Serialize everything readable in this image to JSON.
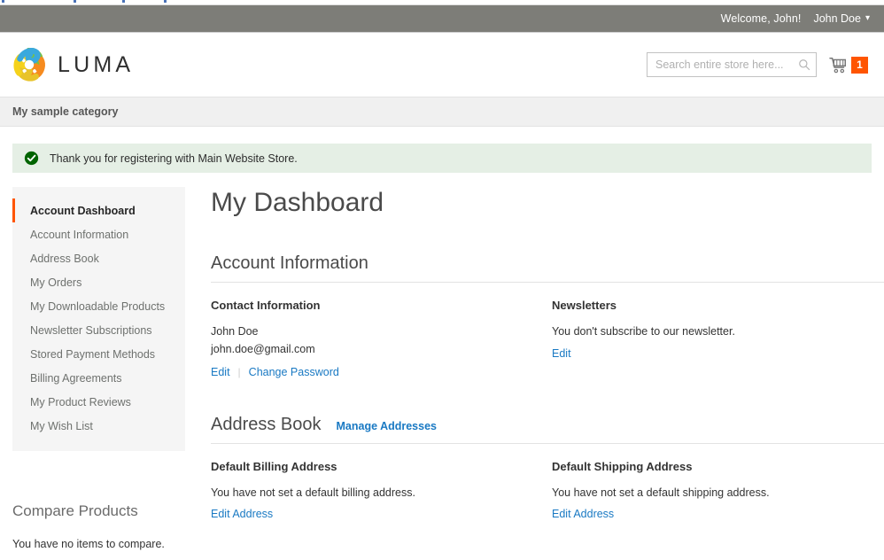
{
  "browser_strip": {
    "fragment_color": "#4a72b8",
    "fragment_count": 4
  },
  "panel": {
    "welcome": "Welcome, John!",
    "customer_name": "John Doe",
    "caret_icon": "chevron-down-icon"
  },
  "header": {
    "logo_text": "LUMA",
    "logo_icon": "luma-flower-logo",
    "search": {
      "placeholder": "Search entire store here...",
      "value": "",
      "icon": "search-icon"
    },
    "cart": {
      "icon": "shopping-cart-icon",
      "count": "1",
      "badge_color": "#ff5501"
    }
  },
  "nav": {
    "items": [
      {
        "label": "My sample category"
      }
    ]
  },
  "message": {
    "icon": "success-check-circle-icon",
    "text": "Thank you for registering with Main Website Store.",
    "background": "#e5efe5",
    "icon_color": "#006400"
  },
  "sidebar": {
    "items": [
      {
        "label": "Account Dashboard",
        "active": true
      },
      {
        "label": "Account Information",
        "active": false
      },
      {
        "label": "Address Book",
        "active": false
      },
      {
        "label": "My Orders",
        "active": false
      },
      {
        "label": "My Downloadable Products",
        "active": false
      },
      {
        "label": "Newsletter Subscriptions",
        "active": false
      },
      {
        "label": "Stored Payment Methods",
        "active": false
      },
      {
        "label": "Billing Agreements",
        "active": false
      },
      {
        "label": "My Product Reviews",
        "active": false
      },
      {
        "label": "My Wish List",
        "active": false
      }
    ],
    "active_marker_color": "#ff5501",
    "compare": {
      "title": "Compare Products",
      "empty_text": "You have no items to compare."
    }
  },
  "main": {
    "page_title": "My Dashboard",
    "account_information": {
      "heading": "Account Information",
      "contact": {
        "title": "Contact Information",
        "name": "John Doe",
        "email": "john.doe@gmail.com",
        "edit_link": "Edit",
        "change_password_link": "Change Password"
      },
      "newsletters": {
        "title": "Newsletters",
        "status": "You don't subscribe to our newsletter.",
        "edit_link": "Edit"
      }
    },
    "address_book": {
      "heading": "Address Book",
      "manage_link": "Manage Addresses",
      "billing": {
        "title": "Default Billing Address",
        "status": "You have not set a default billing address.",
        "edit_link": "Edit Address"
      },
      "shipping": {
        "title": "Default Shipping Address",
        "status": "You have not set a default shipping address.",
        "edit_link": "Edit Address"
      }
    }
  }
}
